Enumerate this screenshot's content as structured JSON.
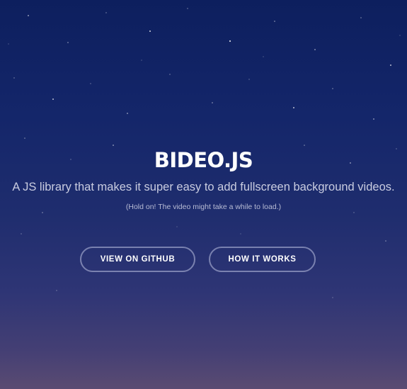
{
  "hero": {
    "title": "BIDEO.JS",
    "tagline": "A JS library that makes it super easy to add fullscreen background videos.",
    "note": "(Hold on! The video might take a while to load.)"
  },
  "buttons": {
    "github_label": "VIEW ON GITHUB",
    "how_label": "HOW IT WORKS"
  },
  "colors": {
    "background_top": "#0d1f5e",
    "background_bottom": "#5a4b72",
    "button_border": "#bec3e1",
    "text": "#ffffff"
  }
}
